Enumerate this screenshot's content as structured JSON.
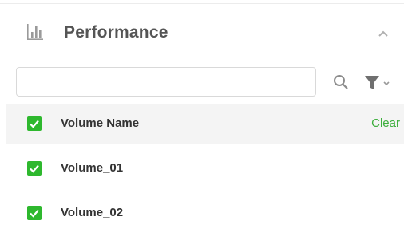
{
  "panel": {
    "title": "Performance",
    "icon": "bar-chart-icon",
    "collapse_icon": "chevron-up-icon"
  },
  "search": {
    "value": "",
    "placeholder": "",
    "search_icon": "search-icon",
    "filter_icon": "filter-icon"
  },
  "list": {
    "header_label": "Volume Name",
    "clear_label": "Clear",
    "items": [
      {
        "label": "Volume_01",
        "checked": true
      },
      {
        "label": "Volume_02",
        "checked": true
      }
    ]
  },
  "colors": {
    "accent_green": "#2eb82e",
    "clear_green": "#3cae3c",
    "header_bg": "#f4f4f4",
    "title_text": "#555555",
    "icon_gray": "#9a9a9a"
  }
}
